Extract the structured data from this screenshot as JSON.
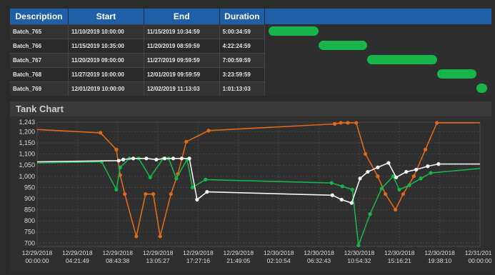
{
  "batch_table": {
    "headers": [
      "Description",
      "Start",
      "End",
      "Duration"
    ],
    "rows": [
      [
        "Batch_765",
        "11/10/2019 10:00:00",
        "11/15/2019 10:34:59",
        "5:00:34:59"
      ],
      [
        "Batch_766",
        "11/15/2019 10:35:00",
        "11/20/2019 08:59:59",
        "4:22:24:59"
      ],
      [
        "Batch_767",
        "11/20/2019 09:00:00",
        "11/27/2019 09:59:59",
        "7:00:59:59"
      ],
      [
        "Batch_768",
        "11/27/2019 10:00:00",
        "12/01/2019 09:59:59",
        "3:23:59:59"
      ],
      [
        "Batch_769",
        "12/01/2019 10:00:00",
        "12/02/2019 11:13:03",
        "1:01:13:03"
      ]
    ],
    "bar_color": "#18b54a",
    "header_color": "#1f5fa8"
  },
  "tank_chart": {
    "title": "Tank Chart"
  },
  "chart_data": {
    "type": "line",
    "title": "Tank Chart",
    "xlabel": "",
    "ylabel": "",
    "x_range": [
      "12/29/2018 00:00:00",
      "12/31/2018 00:00:00"
    ],
    "ylim": [
      685,
      1243
    ],
    "y_ticks": [
      1243,
      1200,
      1150,
      1100,
      1050,
      1000,
      950,
      900,
      850,
      800,
      750,
      700
    ],
    "x_tick_labels": [
      [
        "12/29/2018",
        "00:00:00"
      ],
      [
        "12/29/2018",
        "04:21:49"
      ],
      [
        "12/29/2018",
        "08:43:38"
      ],
      [
        "12/29/2018",
        "13:05:27"
      ],
      [
        "12/29/2018",
        "17:27:16"
      ],
      [
        "12/29/2018",
        "21:49:05"
      ],
      [
        "12/30/2018",
        "02:10:54"
      ],
      [
        "12/30/2018",
        "06:32:43"
      ],
      [
        "12/30/2018",
        "10:54:32"
      ],
      [
        "12/30/2018",
        "15:16:21"
      ],
      [
        "12/30/2018",
        "19:38:10"
      ],
      [
        "12/31/2018",
        "00:00:00"
      ]
    ],
    "grid": true,
    "series": [
      {
        "color": "#e06a1b",
        "x": [
          "12/29/2018 00:00",
          "12/29/2018 06:52",
          "12/29/2018 08:35",
          "12/29/2018 09:00",
          "12/29/2018 09:30",
          "12/29/2018 10:45",
          "12/29/2018 11:45",
          "12/29/2018 12:35",
          "12/29/2018 13:20",
          "12/29/2018 14:30",
          "12/29/2018 15:15",
          "12/29/2018 16:10",
          "12/29/2018 18:35",
          "12/30/2018 08:15",
          "12/30/2018 08:55",
          "12/30/2018 09:40",
          "12/30/2018 10:35",
          "12/30/2018 11:35",
          "12/30/2018 12:55",
          "12/30/2018 13:45",
          "12/30/2018 14:50",
          "12/30/2018 15:40",
          "12/30/2018 16:50",
          "12/30/2018 18:05",
          "12/30/2018 19:20",
          "12/31/2018 00:00"
        ],
        "y": [
          1210,
          1195,
          1120,
          1005,
          920,
          730,
          920,
          920,
          730,
          920,
          1010,
          1155,
          1205,
          1235,
          1240,
          1240,
          1240,
          1100,
          1000,
          920,
          850,
          920,
          1000,
          1120,
          1240,
          1240
        ]
      },
      {
        "color": "#18b54a",
        "x": [
          "12/29/2018 00:00",
          "12/29/2018 07:00",
          "12/29/2018 08:35",
          "12/29/2018 09:00",
          "12/29/2018 10:00",
          "12/29/2018 11:00",
          "12/29/2018 12:15",
          "12/29/2018 13:40",
          "12/29/2018 14:15",
          "12/29/2018 15:05",
          "12/29/2018 16:15",
          "12/29/2018 16:50",
          "12/29/2018 18:15",
          "12/30/2018 07:55",
          "12/30/2018 09:05",
          "12/30/2018 10:10",
          "12/30/2018 10:50",
          "12/30/2018 12:05",
          "12/30/2018 13:20",
          "12/30/2018 14:35",
          "12/30/2018 15:15",
          "12/30/2018 16:20",
          "12/30/2018 17:35",
          "12/30/2018 18:40",
          "12/31/2018 00:00"
        ],
        "y": [
          1060,
          1065,
          940,
          1040,
          1080,
          1080,
          995,
          1080,
          1080,
          990,
          1075,
          950,
          985,
          970,
          955,
          940,
          690,
          830,
          945,
          1000,
          940,
          960,
          990,
          1015,
          1035
        ]
      },
      {
        "color": "#f4f4f4",
        "x": [
          "12/29/2018 00:00",
          "12/29/2018 08:50",
          "12/29/2018 09:20",
          "12/29/2018 10:25",
          "12/29/2018 11:50",
          "12/29/2018 12:55",
          "12/29/2018 13:50",
          "12/29/2018 14:45",
          "12/29/2018 15:40",
          "12/29/2018 16:30",
          "12/29/2018 17:20",
          "12/29/2018 18:25",
          "12/30/2018 08:00",
          "12/30/2018 09:00",
          "12/30/2018 10:05",
          "12/30/2018 11:00",
          "12/30/2018 11:50",
          "12/30/2018 12:55",
          "12/30/2018 14:05",
          "12/30/2018 14:55",
          "12/30/2018 16:00",
          "12/30/2018 17:05",
          "12/30/2018 18:20",
          "12/30/2018 19:30",
          "12/31/2018 00:00"
        ],
        "y": [
          1065,
          1070,
          1075,
          1080,
          1080,
          1075,
          1080,
          1080,
          1080,
          1080,
          895,
          930,
          915,
          895,
          880,
          990,
          1020,
          1040,
          1060,
          995,
          1020,
          1030,
          1045,
          1055,
          1055
        ]
      }
    ]
  }
}
